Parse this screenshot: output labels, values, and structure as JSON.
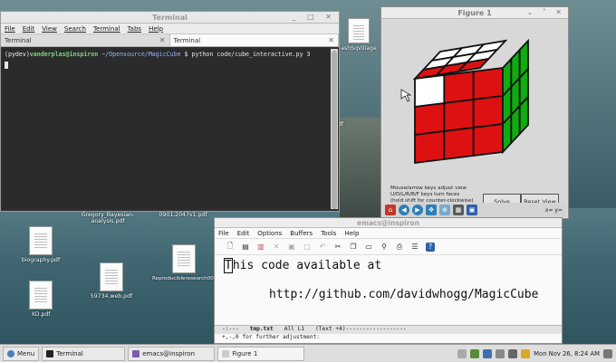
{
  "terminal": {
    "title": "Terminal",
    "menu": [
      "File",
      "Edit",
      "View",
      "Search",
      "Terminal",
      "Tabs",
      "Help"
    ],
    "tabs": [
      {
        "label": "Terminal"
      },
      {
        "label": "Terminal"
      }
    ],
    "prompt_env": "(pydev)",
    "prompt_user": "vanderplas@inspiron",
    "prompt_path": "~/Opensource/MagicCube",
    "prompt_symbol": "$",
    "command": "python code/cube_interactive.py 3"
  },
  "figure": {
    "title": "Figure 1",
    "info_lines": [
      "Mouse/arrow keys adjust view",
      "U/D/L/R/B/F keys turn faces",
      "(hold shift for counter-clockwise)"
    ],
    "solve_button": "Solve Cube",
    "reset_button": "Reset View",
    "coords": "x= y=",
    "cube_colors": {
      "top": "#ffffff",
      "front": "#dd1111",
      "side": "#11aa11",
      "edge": "#111111"
    }
  },
  "emacs": {
    "title": "emacs@inspiron",
    "menu": [
      "File",
      "Edit",
      "Options",
      "Buffers",
      "Tools",
      "Help"
    ],
    "line1": "This code available at",
    "line2": "http://github.com/davidwhogg/MagicCube",
    "mode_prefix": "-:---",
    "buffer": "tmp.txt",
    "position": "All L1",
    "mode": "(Text +4)------------------",
    "minibuffer": "+,-,0 for further adjustment:"
  },
  "desktop": {
    "icons": [
      {
        "label": "biography.pdf"
      },
      {
        "label": "Gregory_Bayesian-analysis.pdf"
      },
      {
        "label": "0901.2047v1.pdf"
      },
      {
        "label": "59734.web.pdf"
      },
      {
        "label": "Reproducibleresearch00000001.pdf"
      },
      {
        "label": "XD.pdf"
      },
      {
        "label": "ashSqVillage"
      },
      {
        "label": "df"
      }
    ]
  },
  "taskbar": {
    "menu_label": "Menu",
    "tasks": [
      {
        "label": "Terminal"
      },
      {
        "label": "emacs@inspiron"
      },
      {
        "label": "Figure 1"
      }
    ],
    "clock": "Mon Nov 26,  8:24 AM"
  }
}
